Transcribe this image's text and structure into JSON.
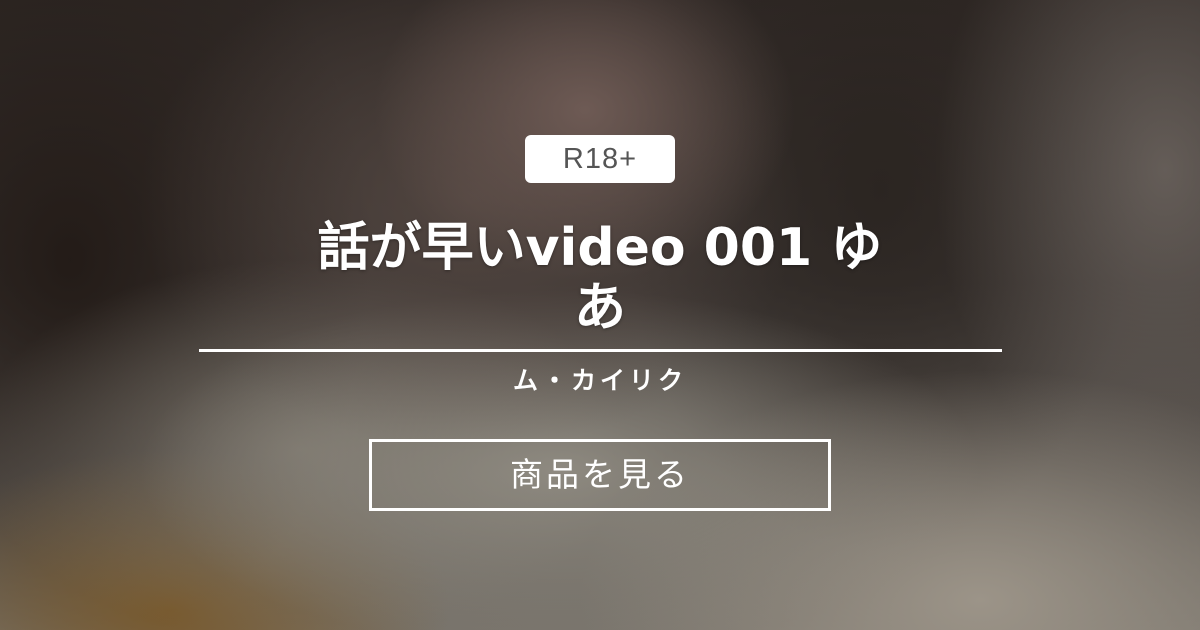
{
  "card": {
    "badge": "R18+",
    "title": "話が早いvideo 001 ゆあ",
    "author": "ム・カイリク",
    "cta_label": "商品を見る"
  },
  "colors": {
    "text": "#ffffff",
    "badge_background": "#ffffff",
    "badge_text": "#555555"
  }
}
